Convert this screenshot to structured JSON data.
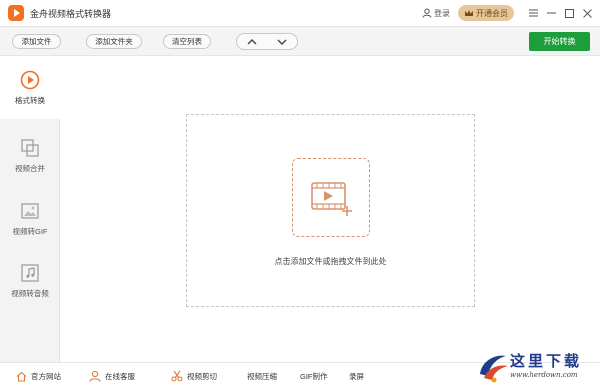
{
  "app": {
    "title": "金舟视频格式转换器"
  },
  "titlebar": {
    "login_label": "登录",
    "vip_label": "开通会员"
  },
  "toolbar": {
    "add_file": "添加文件",
    "add_folder": "添加文件夹",
    "clear_list": "清空列表",
    "start": "开始转换"
  },
  "sidebar": {
    "items": [
      {
        "label": "格式转换",
        "icon": "play-circle-icon",
        "active": true
      },
      {
        "label": "视频合并",
        "icon": "merge-icon",
        "active": false
      },
      {
        "label": "视频转GIF",
        "icon": "image-icon",
        "active": false
      },
      {
        "label": "视频转音频",
        "icon": "music-icon",
        "active": false
      }
    ]
  },
  "dropzone": {
    "hint": "点击添加文件或拖拽文件到此处",
    "icon": "add-video-icon"
  },
  "bottombar": {
    "website": "官方网站",
    "support": "在线客服",
    "video_cut": "视频剪切",
    "video_compress": "视频压缩",
    "gif_make": "GIF制作",
    "screen_record": "录屏"
  },
  "watermark": {
    "text": "这里下载",
    "url": "www.herdown.com"
  },
  "colors": {
    "accent": "#f37021",
    "start": "#1e9e3a",
    "vip": "#e6c79b",
    "drop_border": "#d9926f"
  }
}
